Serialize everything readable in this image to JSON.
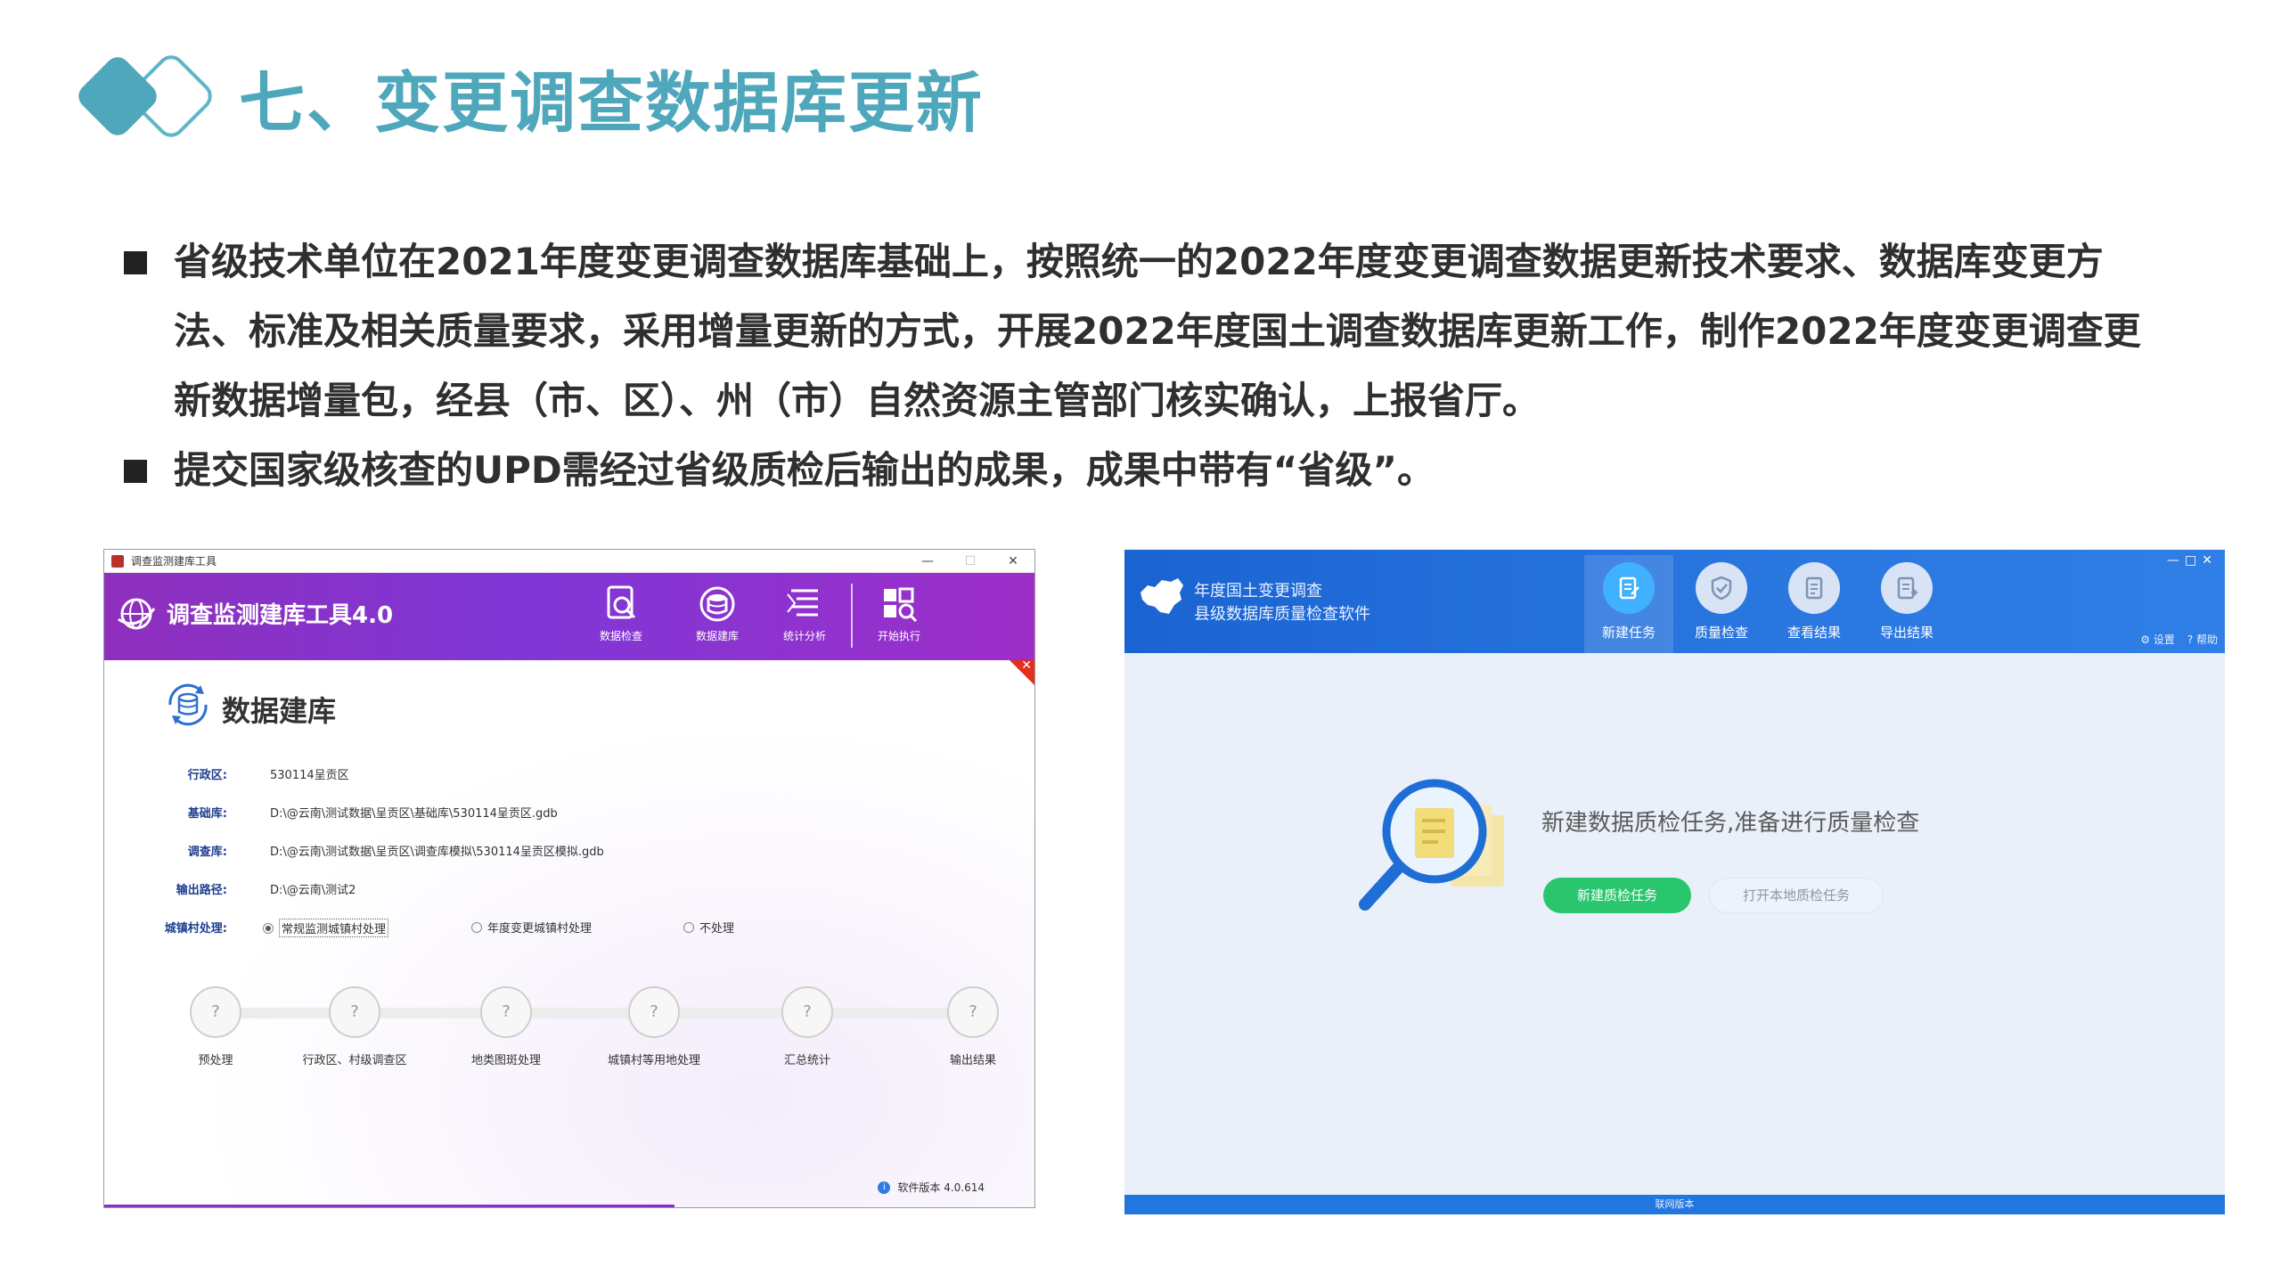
{
  "title": "七、变更调查数据库更新",
  "bullets": [
    "省级技术单位在2021年度变更调查数据库基础上，按照统一的2022年度变更调查数据更新技术要求、数据库变更方法、标准及相关质量要求，采用增量更新的方式，开展2022年度国土调查数据库更新工作，制作2022年度变更调查更新数据增量包，经县（市、区）、州（市）自然资源主管部门核实确认，上报省厅。",
    "提交国家级核查的UPD需经过省级质检后输出的成果，成果中带有“省级”。"
  ],
  "colors": {
    "title": "#4ea7bb",
    "left_header": "#8f2fbd",
    "right_header": "#1a64d2",
    "green_button": "#2ac66e"
  },
  "left_window": {
    "window_title": "调查监测建库工具",
    "window_controls": [
      "—",
      "☐",
      "✕"
    ],
    "app_title": "调查监测建库工具4.0",
    "toolbar": [
      {
        "label": "数据检查",
        "icon": "doc-search-icon"
      },
      {
        "label": "数据建库",
        "icon": "database-icon"
      },
      {
        "label": "统计分析",
        "icon": "list-chart-icon"
      },
      {
        "label": "开始执行",
        "icon": "run-icon"
      }
    ],
    "section_title": "数据建库",
    "form": {
      "region_label": "行政区:",
      "region_value": "530114呈贡区",
      "base_label": "基础库:",
      "base_value": "D:\\@云南\\测试数据\\呈贡区\\基础库\\530114呈贡区.gdb",
      "survey_label": "调查库:",
      "survey_value": "D:\\@云南\\测试数据\\呈贡区\\调查库模拟\\530114呈贡区模拟.gdb",
      "output_label": "输出路径:",
      "output_value": "D:\\@云南\\测试2",
      "process_label": "城镇村处理:",
      "process_options": [
        "常规监测城镇村处理",
        "年度变更城镇村处理",
        "不处理"
      ],
      "process_selected": "常规监测城镇村处理"
    },
    "steps": [
      {
        "symbol": "?",
        "label": "预处理"
      },
      {
        "symbol": "?",
        "label": "行政区、村级调查区"
      },
      {
        "symbol": "?",
        "label": "地类图斑处理"
      },
      {
        "symbol": "?",
        "label": "城镇村等用地处理"
      },
      {
        "symbol": "?",
        "label": "汇总统计"
      },
      {
        "symbol": "?",
        "label": "输出结果"
      }
    ],
    "version": "软件版本 4.0.614"
  },
  "right_window": {
    "title_line1": "年度国土变更调查",
    "title_line2": "县级数据库质量检查软件",
    "window_controls": "—□✕",
    "tabs": [
      {
        "label": "新建任务",
        "icon": "new-task-icon",
        "active": true
      },
      {
        "label": "质量检查",
        "icon": "shield-check-icon",
        "active": false
      },
      {
        "label": "查看结果",
        "icon": "view-result-icon",
        "active": false
      },
      {
        "label": "导出结果",
        "icon": "export-result-icon",
        "active": false
      }
    ],
    "util": {
      "settings": "⚙ 设置",
      "help": "? 帮助"
    },
    "message": "新建数据质检任务,准备进行质量检查",
    "primary_button": "新建质检任务",
    "secondary_button": "打开本地质检任务",
    "status": "联网版本"
  }
}
